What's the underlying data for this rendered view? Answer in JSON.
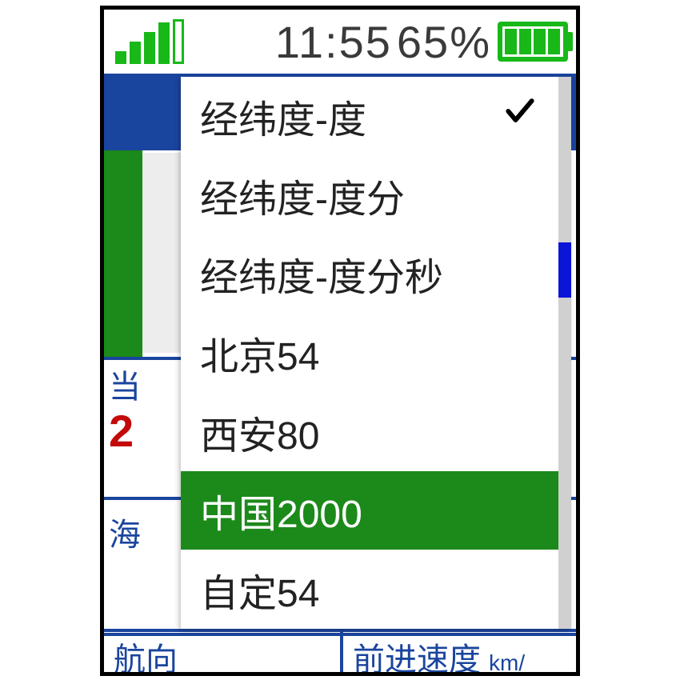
{
  "status": {
    "time": "11:55",
    "battery_pct": "65%"
  },
  "background": {
    "row1_label": "当",
    "row1_value": "2",
    "row2_label": "海",
    "footer_left": "航向",
    "footer_right": "前进速度",
    "footer_right_unit": "km/"
  },
  "popup": {
    "items": [
      {
        "label": "经纬度-度",
        "checked": true,
        "selected": false
      },
      {
        "label": "经纬度-度分",
        "checked": false,
        "selected": false
      },
      {
        "label": "经纬度-度分秒",
        "checked": false,
        "selected": false
      },
      {
        "label": "北京54",
        "checked": false,
        "selected": false
      },
      {
        "label": "西安80",
        "checked": false,
        "selected": false
      },
      {
        "label": "中国2000",
        "checked": false,
        "selected": true
      },
      {
        "label": "自定54",
        "checked": false,
        "selected": false
      }
    ]
  }
}
